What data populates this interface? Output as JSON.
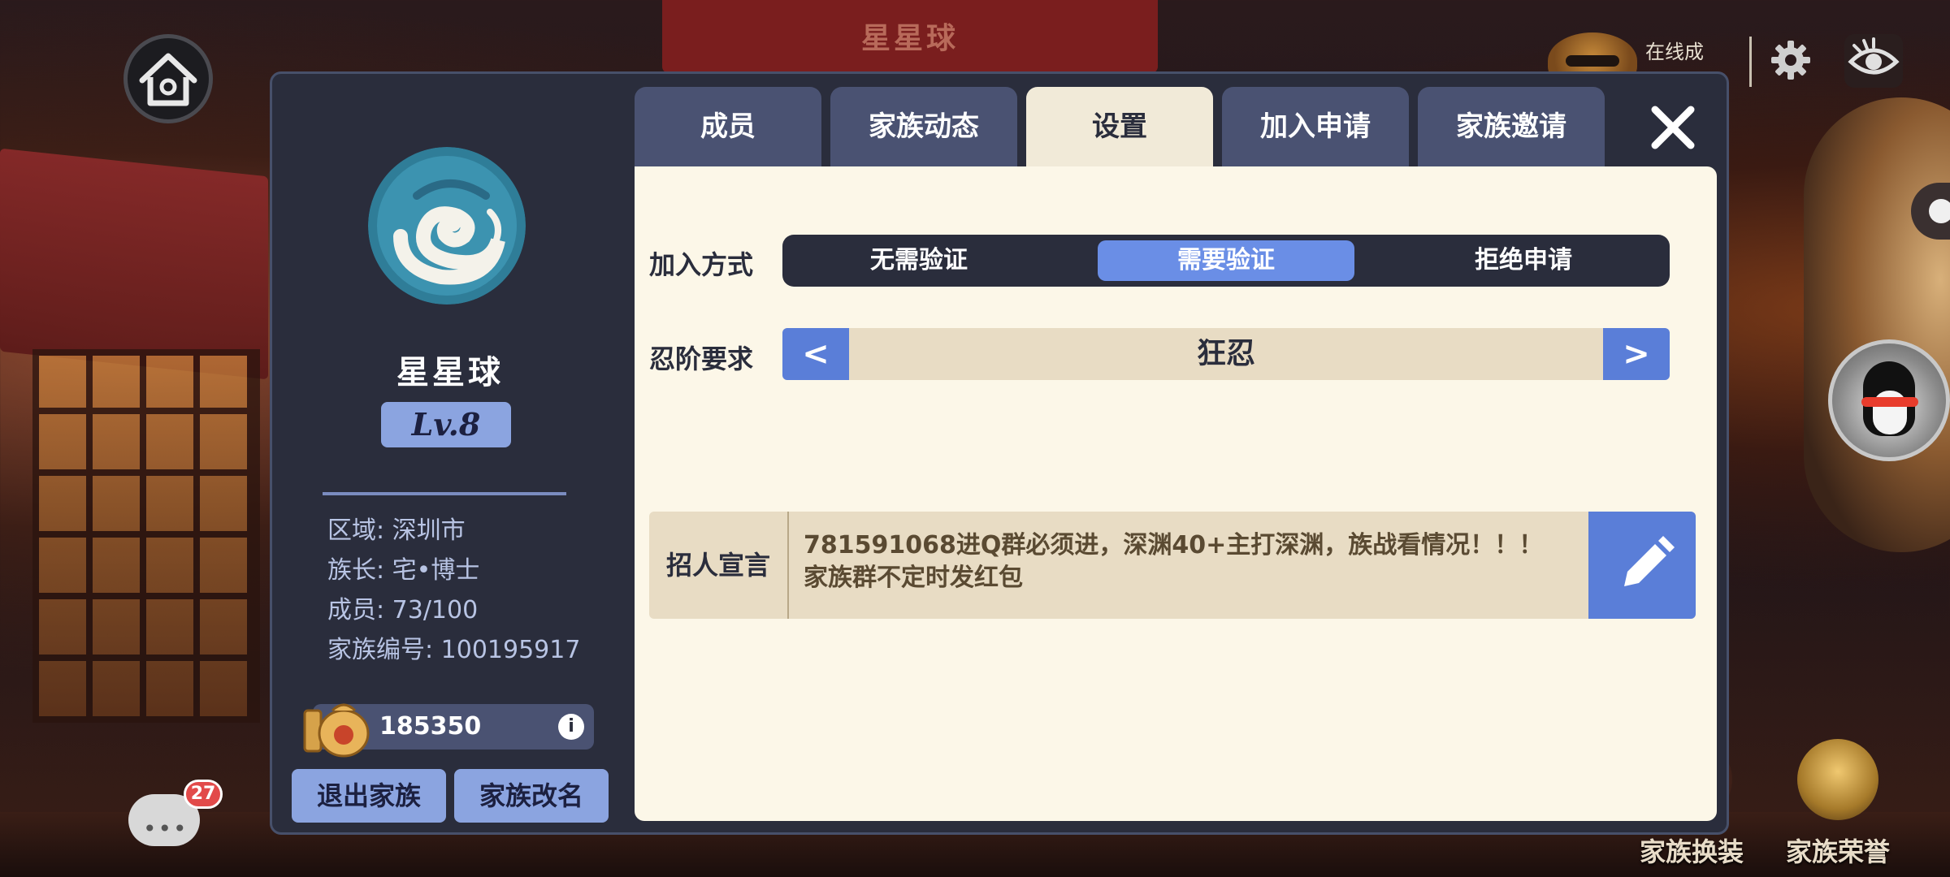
{
  "background": {
    "top_banner_title": "星星球"
  },
  "hud": {
    "online_label": "在线成员",
    "chat_badge": "27"
  },
  "bottom_actions": [
    {
      "label": "家族换装"
    },
    {
      "label": "家族荣誉"
    }
  ],
  "family": {
    "name": "星星球",
    "level": "Lv.8",
    "info": [
      "区域: 深圳市",
      "族长: 宅•博士",
      "成员: 73/100",
      "家族编号: 100195917"
    ],
    "coins": "185350",
    "coin_info_icon": "i",
    "quit_label": "退出家族",
    "rename_label": "家族改名"
  },
  "tabs": [
    {
      "label": "成员",
      "active": false
    },
    {
      "label": "家族动态",
      "active": false
    },
    {
      "label": "设置",
      "active": true
    },
    {
      "label": "加入申请",
      "active": false
    },
    {
      "label": "家族邀请",
      "active": false
    }
  ],
  "settings": {
    "join_method_label": "加入方式",
    "join_options": [
      {
        "label": "无需验证",
        "selected": false
      },
      {
        "label": "需要验证",
        "selected": true
      },
      {
        "label": "拒绝申请",
        "selected": false
      }
    ],
    "rank_label": "忍阶要求",
    "rank_value": "狂忍",
    "prev_arrow": "<",
    "next_arrow": ">",
    "recruit_label": "招人宣言",
    "recruit_text": "781591068进Q群必须进，深渊40+主打深渊，族战看情况！！！ 家族群不定时发红包"
  },
  "colors": {
    "dialog_bg": "#2a2d3c",
    "content_bg": "#fcf7e8",
    "accent": "#6a8ee6",
    "tab_bg": "#4a5272",
    "badge_red": "#e24a4a"
  },
  "icons": {
    "home": "home-icon",
    "chat": "chat-icon",
    "gear": "gear-icon",
    "eye": "eye-icon",
    "close": "close-icon",
    "edit": "pencil-icon",
    "emblem": "swirl-emblem-icon",
    "coin": "coin-bag-icon",
    "qq": "qq-penguin-icon"
  }
}
